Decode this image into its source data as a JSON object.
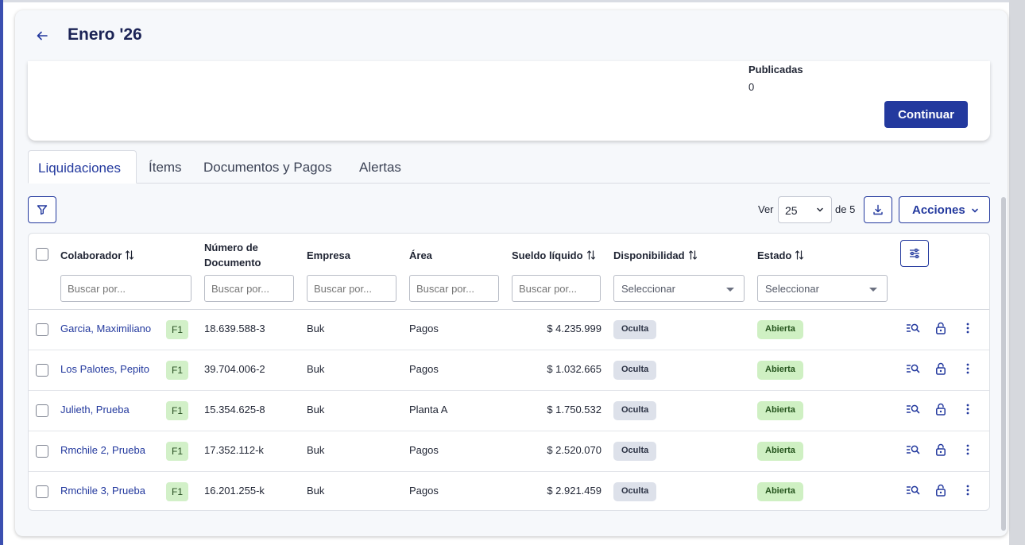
{
  "header": {
    "title": "Enero '26",
    "back_icon": "arrow-left-icon"
  },
  "summary": {
    "published_label": "Publicadas",
    "published_value": "0",
    "continue_label": "Continuar"
  },
  "tabs": [
    {
      "label": "Liquidaciones",
      "active": true
    },
    {
      "label": "Ítems",
      "active": false
    },
    {
      "label": "Documentos y Pagos",
      "active": false
    },
    {
      "label": "Alertas",
      "active": false
    }
  ],
  "toolbar": {
    "filter_icon": "funnel-icon",
    "ver_label": "Ver",
    "per_page": "25",
    "of_label": "de 5",
    "download_icon": "download-icon",
    "actions_label": "Acciones"
  },
  "table": {
    "columns": {
      "colaborador": "Colaborador",
      "documento": "Número de Documento",
      "empresa": "Empresa",
      "area": "Área",
      "sueldo": "Sueldo líquido",
      "disponibilidad": "Disponibilidad",
      "estado": "Estado"
    },
    "search_placeholder": "Buscar por...",
    "select_placeholder": "Seleccionar",
    "rows": [
      {
        "name": "Garcia, Maximiliano",
        "tag": "F1",
        "doc": "18.639.588-3",
        "empresa": "Buk",
        "area": "Pagos",
        "sueldo": "$ 4.235.999",
        "disponibilidad": "Oculta",
        "estado": "Abierta"
      },
      {
        "name": "Los Palotes, Pepito",
        "tag": "F1",
        "doc": "39.704.006-2",
        "empresa": "Buk",
        "area": "Pagos",
        "sueldo": "$ 1.032.665",
        "disponibilidad": "Oculta",
        "estado": "Abierta"
      },
      {
        "name": "Julieth, Prueba",
        "tag": "F1",
        "doc": "15.354.625-8",
        "empresa": "Buk",
        "area": "Planta A",
        "sueldo": "$ 1.750.532",
        "disponibilidad": "Oculta",
        "estado": "Abierta"
      },
      {
        "name": "Rmchile 2, Prueba",
        "tag": "F1",
        "doc": "17.352.112-k",
        "empresa": "Buk",
        "area": "Pagos",
        "sueldo": "$ 2.520.070",
        "disponibilidad": "Oculta",
        "estado": "Abierta"
      },
      {
        "name": "Rmchile 3, Prueba",
        "tag": "F1",
        "doc": "16.201.255-k",
        "empresa": "Buk",
        "area": "Pagos",
        "sueldo": "$ 2.921.459",
        "disponibilidad": "Oculta",
        "estado": "Abierta"
      }
    ]
  },
  "colors": {
    "primary": "#23399e",
    "title": "#1b2355",
    "tag_green": "#d2f0c8",
    "badge_grey": "#dde1ea"
  }
}
